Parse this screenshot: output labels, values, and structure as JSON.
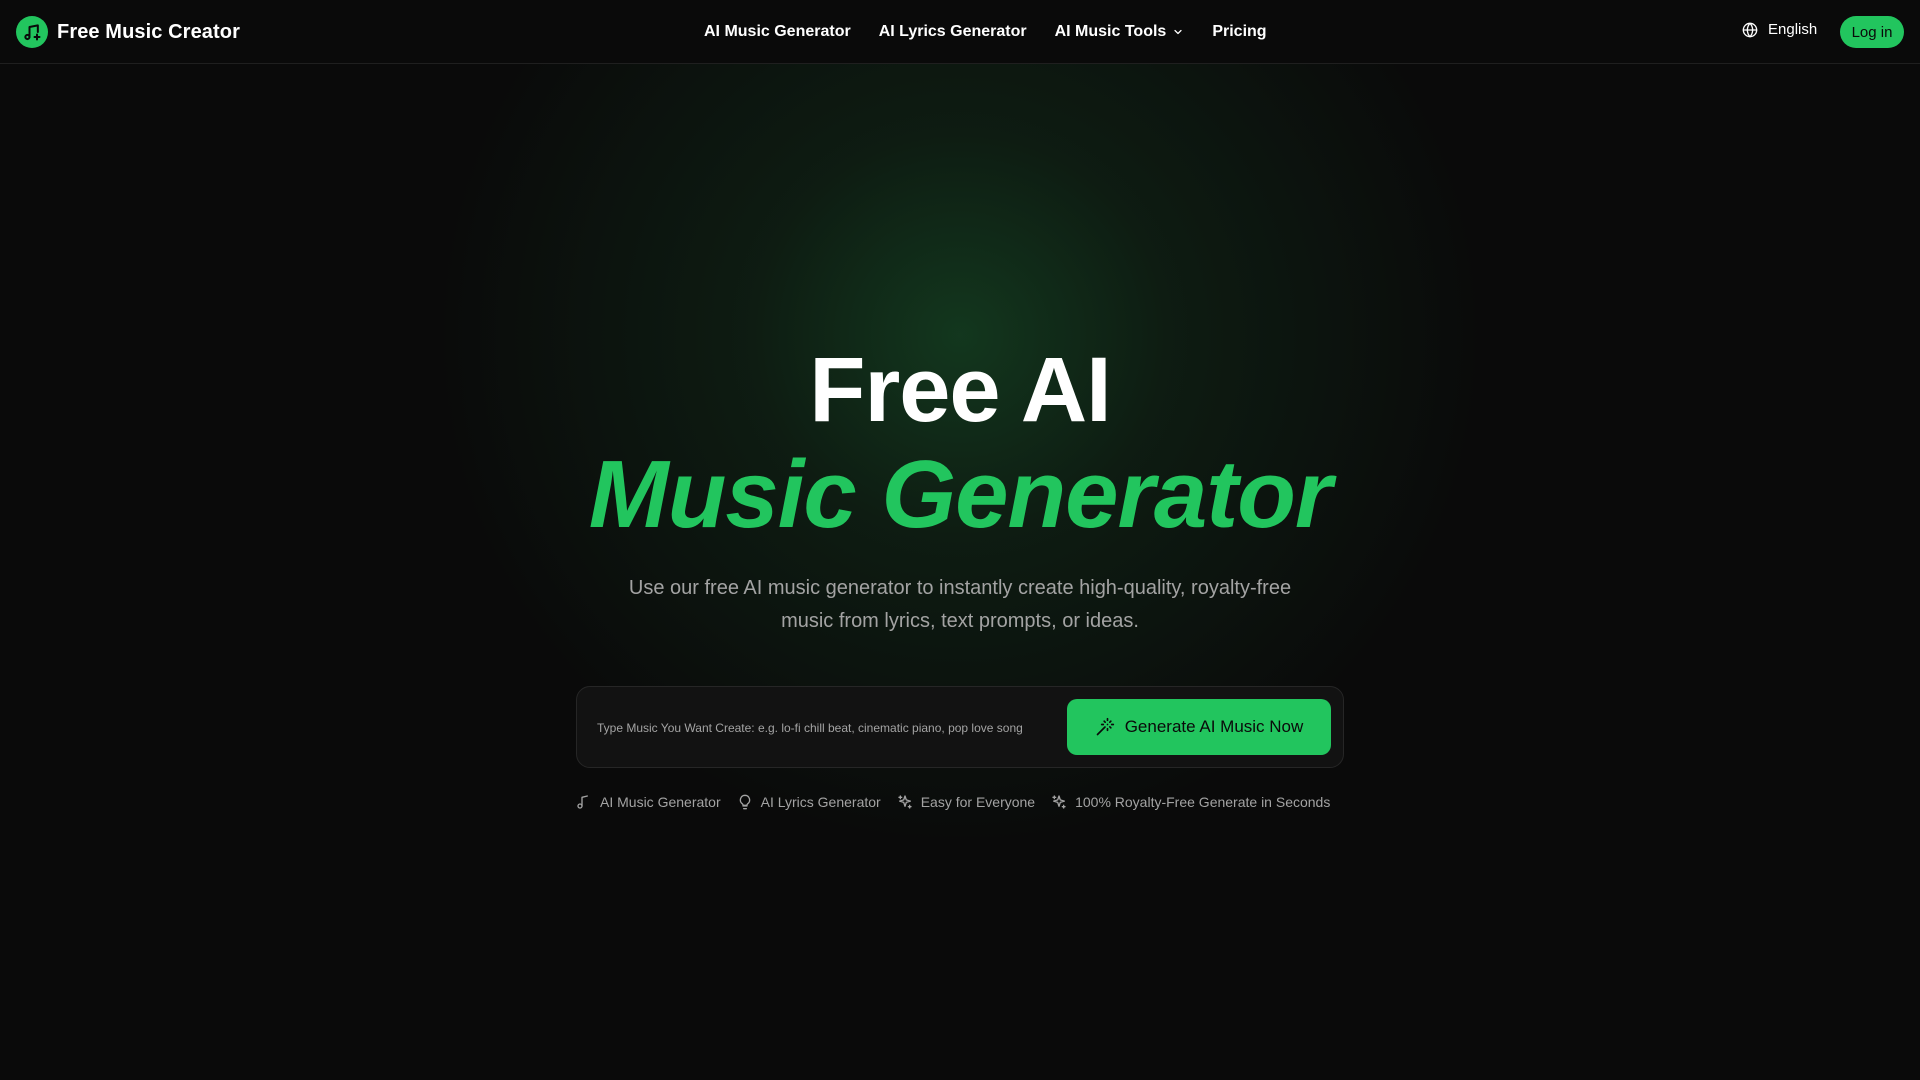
{
  "header": {
    "brand_name": "Free Music Creator",
    "nav": [
      {
        "label": "AI Music Generator"
      },
      {
        "label": "AI Lyrics Generator"
      },
      {
        "label": "AI Music Tools"
      },
      {
        "label": "Pricing"
      }
    ],
    "language": "English",
    "login_label": "Log in"
  },
  "hero": {
    "title_line1": "Free AI",
    "title_line2": "Music Generator",
    "subtitle": "Use our free AI music generator to instantly create high-quality, royalty-free music from lyrics, text prompts, or ideas.",
    "prompt_placeholder": "Type Music You Want Create: e.g. lo-fi chill beat, cinematic piano, pop love song",
    "prompt_value": "",
    "generate_label": "Generate AI Music Now"
  },
  "features": [
    {
      "icon": "music-note-icon",
      "label": "AI Music Generator"
    },
    {
      "icon": "lightbulb-icon",
      "label": "AI Lyrics Generator"
    },
    {
      "icon": "sparkles-icon",
      "label": "Easy for Everyone"
    },
    {
      "icon": "sparkles-icon",
      "label": "100% Royalty-Free Generate in Seconds"
    }
  ],
  "colors": {
    "background": "#0a0a0a",
    "accent": "#22c55e",
    "muted_text": "#a3a3a3"
  }
}
